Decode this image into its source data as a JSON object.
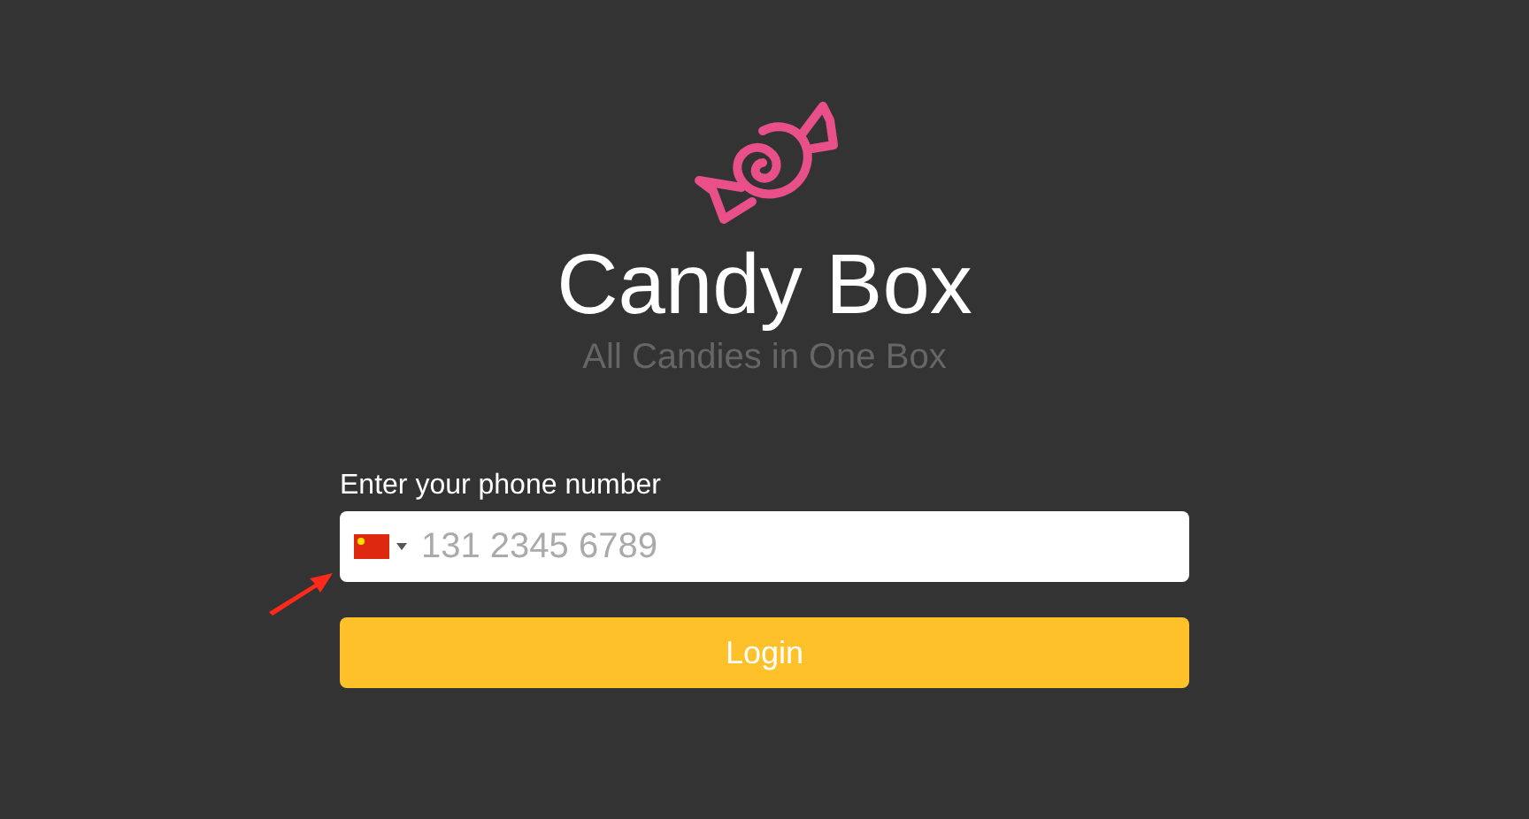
{
  "app": {
    "title": "Candy Box",
    "subtitle": "All Candies in One Box"
  },
  "form": {
    "label": "Enter your phone number",
    "phone": {
      "placeholder": "131 2345 6789"
    },
    "submit": "Login"
  }
}
